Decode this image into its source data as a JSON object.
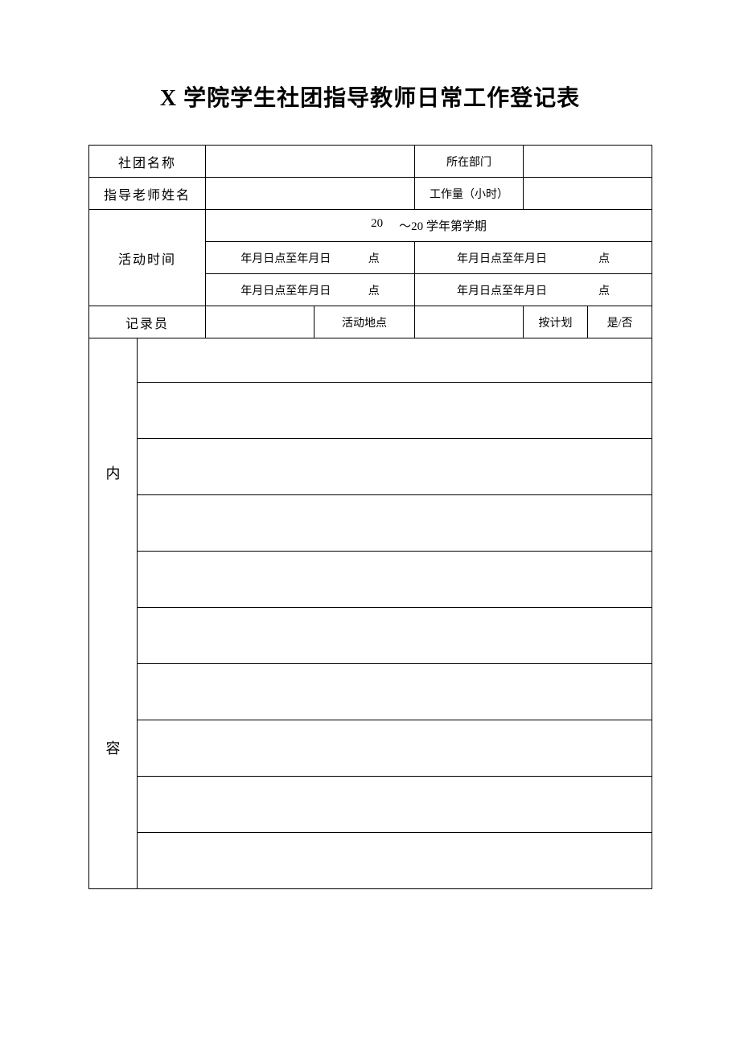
{
  "title": "X 学院学生社团指导教师日常工作登记表",
  "labels": {
    "club_name": "社团名称",
    "department": "所在部门",
    "teacher_name": "指导老师姓名",
    "workload": "工作量（小时）",
    "activity_time": "活动时间",
    "semester_prefix": "20",
    "semester_suffix": "～20 学年第学期",
    "time_range": "年月日点至年月日",
    "dian": "点",
    "recorder": "记录员",
    "activity_place": "活动地点",
    "as_planned": "按计划",
    "yes_no": "是/否",
    "content_top": "内",
    "content_bottom": "容"
  },
  "values": {
    "club_name": "",
    "department": "",
    "teacher_name": "",
    "workload": "",
    "recorder": "",
    "activity_place": "",
    "as_planned": ""
  }
}
